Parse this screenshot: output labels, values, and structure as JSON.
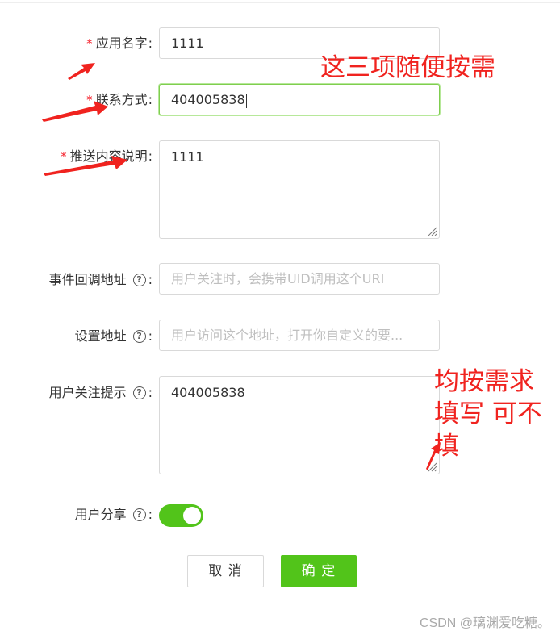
{
  "form": {
    "app_name": {
      "label": "应用名字",
      "value": "1111",
      "required": true
    },
    "contact": {
      "label": "联系方式",
      "value": "404005838",
      "required": true
    },
    "push_desc": {
      "label": "推送内容说明",
      "value": "1111",
      "required": true
    },
    "callback_url": {
      "label": "事件回调地址",
      "placeholder": "用户关注时，会携带UID调用这个URI",
      "value": ""
    },
    "settings_url": {
      "label": "设置地址",
      "placeholder": "用户访问这个地址，打开你自定义的要...",
      "value": ""
    },
    "follow_tip": {
      "label": "用户关注提示",
      "value": "404005838"
    },
    "share": {
      "label": "用户分享",
      "enabled": true
    },
    "colon": ":",
    "required_mark": "*",
    "help_glyph": "?"
  },
  "buttons": {
    "cancel": "取 消",
    "confirm": "确 定"
  },
  "annotations": {
    "top": "这三项随便按需",
    "bottom": "均按需求填写 可不填"
  },
  "watermark": "CSDN @璃渊爱吃糖。",
  "colors": {
    "accent": "#52c41a",
    "annotation": "#f0231f",
    "required": "#f5222d"
  }
}
